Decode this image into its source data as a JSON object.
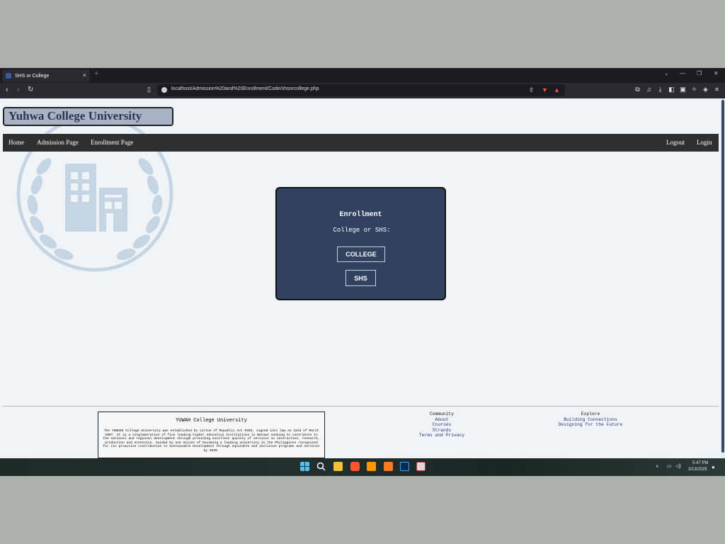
{
  "browser": {
    "tab_title": "SHS or College",
    "tab_close": "×",
    "new_tab": "+",
    "url": "localhost/Admission%20and%20Enrollment/Code/shsorcollege.php",
    "nav_back": "‹",
    "nav_forward": "›",
    "nav_reload": "↻"
  },
  "site": {
    "title": "Yuhwa College University",
    "nav_left": [
      "Home",
      "Admission Page",
      "Enrollment Page"
    ],
    "nav_right": [
      "Logout",
      "Login"
    ]
  },
  "card": {
    "title": "Enrollment",
    "subtitle": "College or SHS:",
    "buttons": [
      "COLLEGE",
      "SHS"
    ]
  },
  "footer": {
    "about_title": "YUWAH College University",
    "about_text": "The YUWUSH College University was established by virtue of Republic Act 9403, signed into law on 22nd of March 2007. It is a conglomeration of fine leading higher education institutions in Bataan seeking to contribute to the national and regional development through providing excellent quality of services in instruction, research, production and extension. Guided by one Vision of becoming a leading university in the Philippines recognized for its proactive contribution to Sustainable Development through equitable and inclusive programs and services by 2030.",
    "community_heading": "Community",
    "community_links": [
      "About",
      "Courses",
      "Strands",
      "Terms and Privacy"
    ],
    "explore_heading": "Explore",
    "explore_links": [
      "Building Connections",
      "Designing for the Future"
    ]
  },
  "taskbar": {
    "time": "5:47 PM",
    "date": "3/13/2025"
  },
  "colors": {
    "card_bg": "#334161",
    "navbar_bg": "#2f2f2f",
    "title_bg": "#a8b3c7",
    "page_bg": "#f0f4f6"
  }
}
